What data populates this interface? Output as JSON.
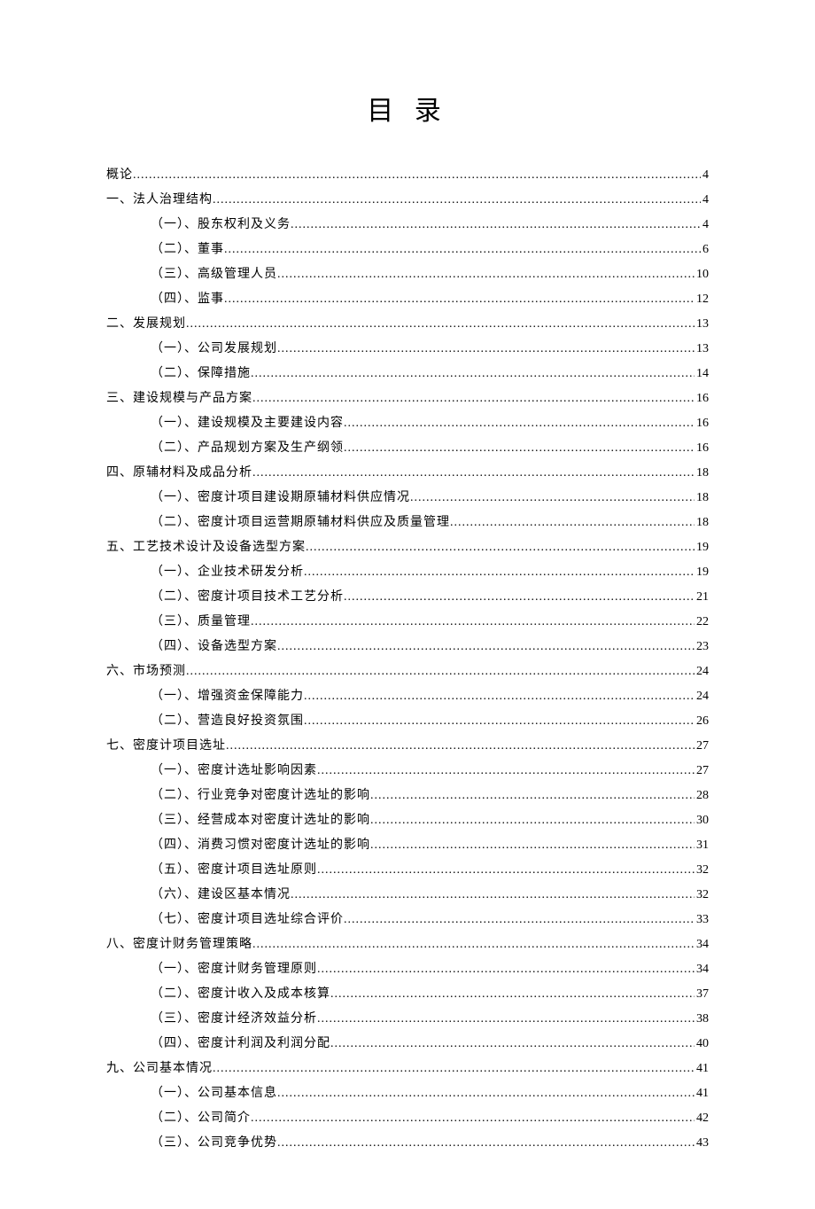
{
  "title": "目 录",
  "toc": [
    {
      "level": 0,
      "label": "概论",
      "page": "4"
    },
    {
      "level": 0,
      "label": "一、法人治理结构",
      "page": "4"
    },
    {
      "level": 1,
      "label": "（一）、股东权利及义务",
      "page": "4"
    },
    {
      "level": 1,
      "label": "（二）、董事",
      "page": "6"
    },
    {
      "level": 1,
      "label": "（三）、高级管理人员",
      "page": "10"
    },
    {
      "level": 1,
      "label": "（四）、监事",
      "page": "12"
    },
    {
      "level": 0,
      "label": "二、发展规划",
      "page": "13"
    },
    {
      "level": 1,
      "label": "（一）、公司发展规划",
      "page": "13"
    },
    {
      "level": 1,
      "label": "（二）、保障措施",
      "page": "14"
    },
    {
      "level": 0,
      "label": "三、建设规模与产品方案",
      "page": "16"
    },
    {
      "level": 1,
      "label": "（一）、建设规模及主要建设内容",
      "page": "16"
    },
    {
      "level": 1,
      "label": "（二）、产品规划方案及生产纲领",
      "page": "16"
    },
    {
      "level": 0,
      "label": "四、原辅材料及成品分析",
      "page": "18"
    },
    {
      "level": 1,
      "label": "（一）、密度计项目建设期原辅材料供应情况",
      "page": "18"
    },
    {
      "level": 1,
      "label": "（二）、密度计项目运营期原辅材料供应及质量管理",
      "page": "18"
    },
    {
      "level": 0,
      "label": "五、工艺技术设计及设备选型方案",
      "page": "19"
    },
    {
      "level": 1,
      "label": "（一）、企业技术研发分析",
      "page": "19"
    },
    {
      "level": 1,
      "label": "（二）、密度计项目技术工艺分析",
      "page": "21"
    },
    {
      "level": 1,
      "label": "（三）、质量管理",
      "page": "22"
    },
    {
      "level": 1,
      "label": "（四）、设备选型方案",
      "page": "23"
    },
    {
      "level": 0,
      "label": "六、市场预测",
      "page": "24"
    },
    {
      "level": 1,
      "label": "（一）、增强资金保障能力",
      "page": "24"
    },
    {
      "level": 1,
      "label": "（二）、营造良好投资氛围",
      "page": "26"
    },
    {
      "level": 0,
      "label": "七、密度计项目选址",
      "page": "27"
    },
    {
      "level": 1,
      "label": "（一）、密度计选址影响因素",
      "page": "27"
    },
    {
      "level": 1,
      "label": "（二）、行业竞争对密度计选址的影响",
      "page": "28"
    },
    {
      "level": 1,
      "label": "（三）、经营成本对密度计选址的影响",
      "page": "30"
    },
    {
      "level": 1,
      "label": "（四）、消费习惯对密度计选址的影响",
      "page": "31"
    },
    {
      "level": 1,
      "label": "（五）、密度计项目选址原则",
      "page": "32"
    },
    {
      "level": 1,
      "label": "（六）、建设区基本情况",
      "page": "32"
    },
    {
      "level": 1,
      "label": "（七）、密度计项目选址综合评价",
      "page": "33"
    },
    {
      "level": 0,
      "label": "八、密度计财务管理策略",
      "page": "34"
    },
    {
      "level": 1,
      "label": "（一）、密度计财务管理原则",
      "page": "34"
    },
    {
      "level": 1,
      "label": "（二）、密度计收入及成本核算",
      "page": "37"
    },
    {
      "level": 1,
      "label": "（三）、密度计经济效益分析",
      "page": "38"
    },
    {
      "level": 1,
      "label": "（四）、密度计利润及利润分配",
      "page": "40"
    },
    {
      "level": 0,
      "label": "九、公司基本情况",
      "page": "41"
    },
    {
      "level": 1,
      "label": "（一）、公司基本信息",
      "page": "41"
    },
    {
      "level": 1,
      "label": "（二）、公司简介",
      "page": "42"
    },
    {
      "level": 1,
      "label": "（三）、公司竞争优势",
      "page": "43"
    }
  ]
}
